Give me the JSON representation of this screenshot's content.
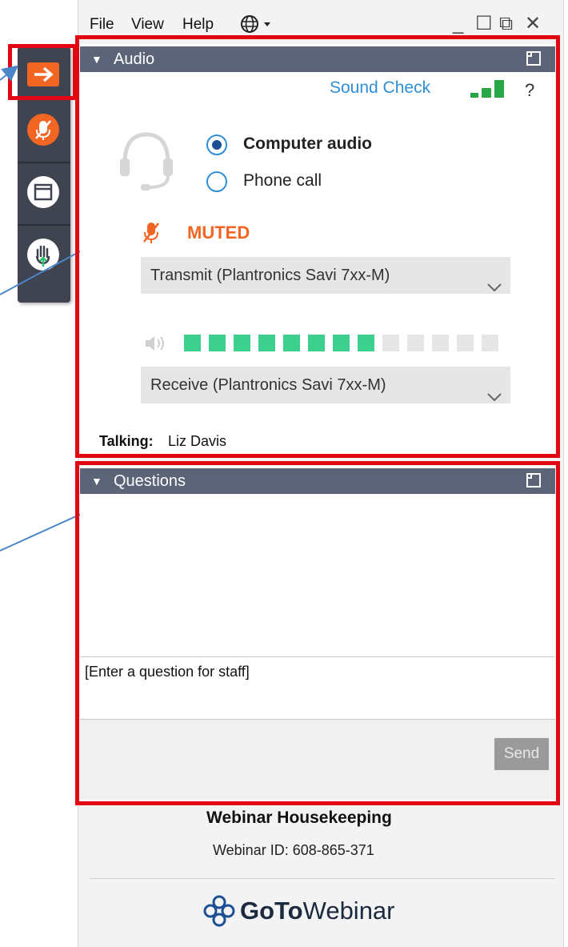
{
  "menu": {
    "file": "File",
    "view": "View",
    "help": "Help"
  },
  "window_controls": {
    "minimize": "_",
    "maximize": "☐",
    "popout": "⧉",
    "close": "✕"
  },
  "sidebar": {
    "items": [
      {
        "icon": "arrow-right-icon",
        "color": "#f26522"
      },
      {
        "icon": "microphone-muted-icon",
        "color": "#f26522"
      },
      {
        "icon": "window-icon",
        "color": "#ffffff"
      },
      {
        "icon": "raise-hand-icon",
        "color": "#ffffff"
      }
    ]
  },
  "audio": {
    "title": "Audio",
    "sound_check": "Sound Check",
    "help": "?",
    "options": {
      "computer": "Computer audio",
      "phone": "Phone call",
      "selected": "computer"
    },
    "muted_label": "MUTED",
    "transmit": "Transmit (Plantronics Savi 7xx-M)",
    "receive": "Receive (Plantronics Savi 7xx-M)",
    "level": {
      "active": 8,
      "total": 13
    },
    "talking_label": "Talking:",
    "talking_name": "Liz Davis"
  },
  "questions": {
    "title": "Questions",
    "placeholder": "[Enter a question for staff]",
    "send": "Send"
  },
  "footer": {
    "title": "Webinar Housekeeping",
    "webinar_id": "Webinar ID: 608-865-371",
    "logo_bold": "GoTo",
    "logo_light": "Webinar"
  },
  "colors": {
    "accent_red": "#e30613",
    "header": "#5c6478",
    "link_blue": "#2e8fd6",
    "muted_orange": "#f26522",
    "level_green": "#3ccf8e"
  }
}
